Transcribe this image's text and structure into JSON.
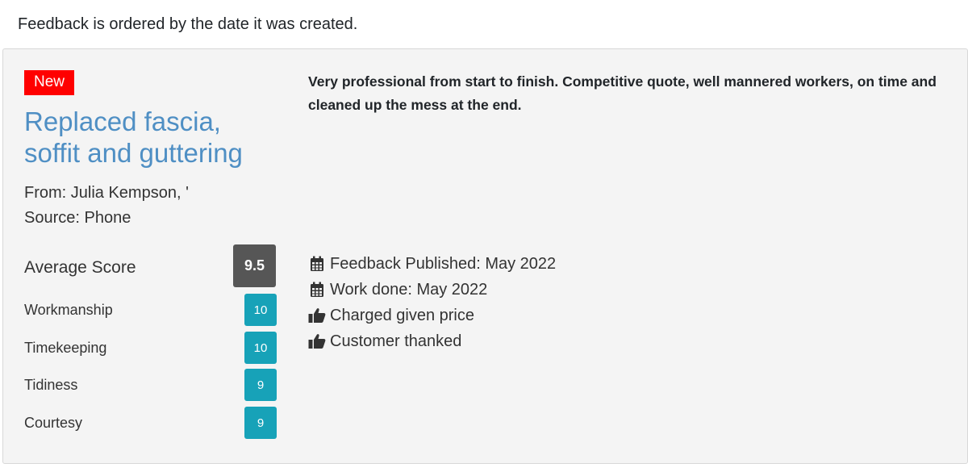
{
  "intro": "Feedback is ordered by the date it was created.",
  "feedback": {
    "badge": "New",
    "title": "Replaced fascia, soffit and guttering",
    "from": "From: Julia Kempson, '",
    "source": "Source: Phone",
    "average_label": "Average Score",
    "average_score": "9.5",
    "scores": [
      {
        "label": "Workmanship",
        "value": "10"
      },
      {
        "label": "Timekeeping",
        "value": "10"
      },
      {
        "label": "Tidiness",
        "value": "9"
      },
      {
        "label": "Courtesy",
        "value": "9"
      }
    ],
    "comment": "Very professional from start to finish. Competitive quote, well mannered workers, on time and cleaned up the mess at the end.",
    "facts": [
      {
        "icon": "calendar-icon",
        "text": "Feedback Published: May 2022"
      },
      {
        "icon": "calendar-icon",
        "text": "Work done: May 2022"
      },
      {
        "icon": "thumbs-up-icon",
        "text": "Charged given price"
      },
      {
        "icon": "thumbs-up-icon",
        "text": "Customer thanked"
      }
    ],
    "colors": {
      "badge": "#ff0000",
      "title": "#4f8fc4",
      "average_badge": "#565656",
      "score_badge": "#17a2b8",
      "card_bg": "#f4f4f4"
    }
  }
}
